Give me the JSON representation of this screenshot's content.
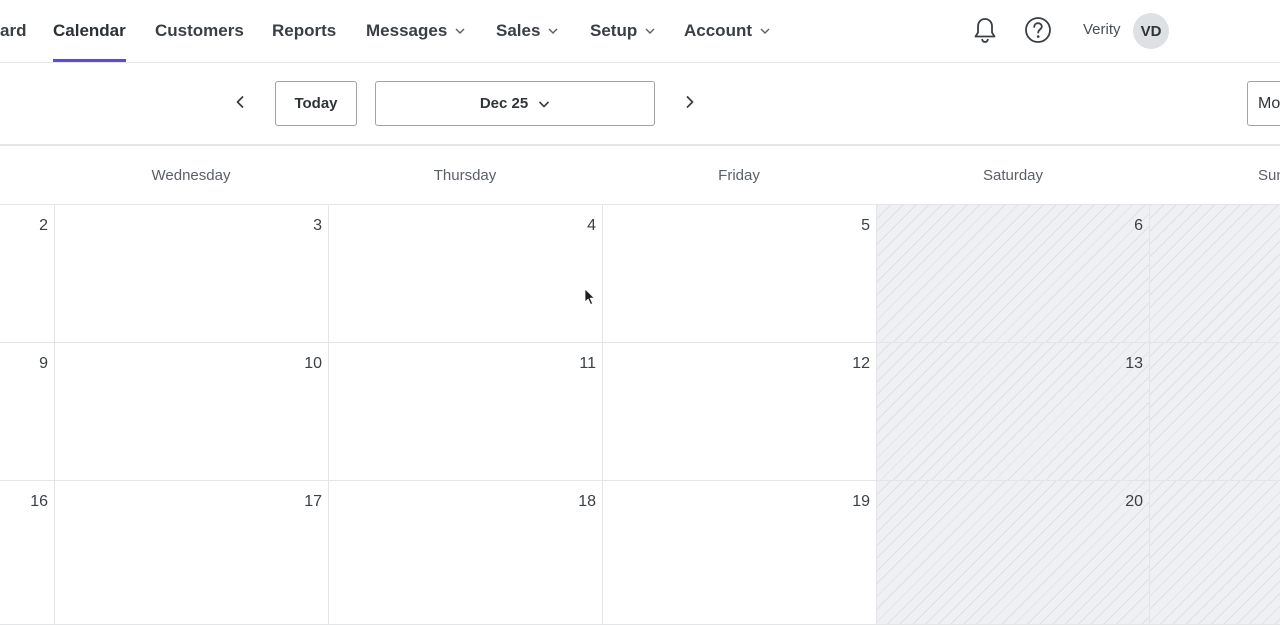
{
  "nav": {
    "items": [
      {
        "label": "ard",
        "has_menu": false
      },
      {
        "label": "Calendar",
        "has_menu": false,
        "active": true
      },
      {
        "label": "Customers",
        "has_menu": false
      },
      {
        "label": "Reports",
        "has_menu": false
      },
      {
        "label": "Messages",
        "has_menu": true
      },
      {
        "label": "Sales",
        "has_menu": true
      },
      {
        "label": "Setup",
        "has_menu": true
      },
      {
        "label": "Account",
        "has_menu": true
      }
    ],
    "icons": [
      "bell-icon",
      "help-icon"
    ],
    "user_name": "Verity",
    "user_initials": "VD",
    "accent_color": "#5b4fc9"
  },
  "toolbar": {
    "prev_icon": "chevron-left-icon",
    "today_label": "Today",
    "date_label": "Dec 25",
    "next_icon": "chevron-right-icon",
    "view_label": "Mo"
  },
  "calendar": {
    "day_names": [
      "Wednesday",
      "Thursday",
      "Friday",
      "Saturday",
      "Sun"
    ],
    "weeks": [
      [
        "2",
        "3",
        "4",
        "5",
        "6",
        ""
      ],
      [
        "9",
        "10",
        "11",
        "12",
        "13",
        ""
      ],
      [
        "16",
        "17",
        "18",
        "19",
        "20",
        ""
      ]
    ],
    "weekend_color": "#eef0f4"
  }
}
